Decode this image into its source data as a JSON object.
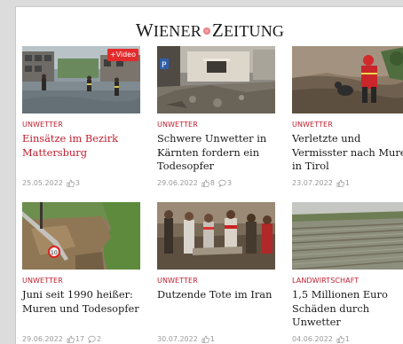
{
  "logo": {
    "w1_big": "W",
    "w1_rest": "IENER",
    "w2_big": "Z",
    "w2_rest": "EITUNG"
  },
  "articles": [
    {
      "category": "UNWETTER",
      "title_lines": [
        "Einsätze im Bezirk",
        "Mattersburg"
      ],
      "date": "25.05.2022",
      "likes": "3",
      "comments": "",
      "badge": "+Video",
      "icons": [
        "thumbs-up-icon"
      ]
    },
    {
      "category": "UNWETTER",
      "title_lines": [
        "Schwere Unwetter in",
        "Kärnten fordern ein",
        "Todesopfer"
      ],
      "date": "29.06.2022",
      "likes": "8",
      "comments": "3",
      "icons": [
        "thumbs-up-icon",
        "comment-icon"
      ]
    },
    {
      "category": "UNWETTER",
      "title_lines": [
        "Verletzte und",
        "Vermisster nach Muren",
        "in Tirol"
      ],
      "date": "23.07.2022",
      "likes": "1",
      "comments": "",
      "icons": [
        "thumbs-up-icon"
      ]
    },
    {
      "category": "UNWETTER",
      "title_lines": [
        "Juni seit 1990 heißer:",
        "Muren und Todesopfer"
      ],
      "date": "29.06.2022",
      "likes": "17",
      "comments": "2",
      "icons": [
        "thumbs-up-icon",
        "comment-icon"
      ]
    },
    {
      "category": "UNWETTER",
      "title_lines": [
        "Dutzende Tote im Iran"
      ],
      "date": "30.07.2022",
      "likes": "1",
      "comments": "",
      "icons": [
        "thumbs-up-icon"
      ]
    },
    {
      "category": "LANDWIRTSCHAFT",
      "title_lines": [
        "1,5 Millionen Euro",
        "Schäden durch",
        "Unwetter"
      ],
      "date": "04.06.2022",
      "likes": "1",
      "comments": "",
      "icons": [
        "thumbs-up-icon"
      ]
    }
  ],
  "colors": {
    "accent_red": "#c01e2e",
    "badge_red": "#e32b2b",
    "meta_gray": "#9a9a9a",
    "text": "#1a1a1a"
  }
}
